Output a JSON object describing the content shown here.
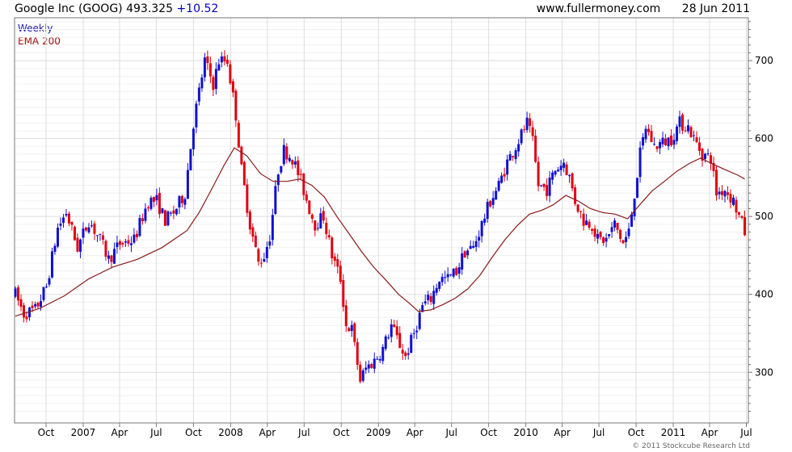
{
  "header": {
    "ticker": "Google Inc (GOOG)",
    "price": "493.325",
    "change": "+10.52",
    "site": "www.fullermoney.com",
    "date": "28 Jun 2011"
  },
  "legend": {
    "weekly": "Weekly",
    "ema": "EMA 200"
  },
  "copyright": "© 2011 Stockcube Research Ltd",
  "colors": {
    "up": "#1010d0",
    "down": "#e00010",
    "ema": "#8b1a1a",
    "grid": "#dddddd",
    "frame": "#777777"
  },
  "chart_data": {
    "type": "candlestick",
    "grid": true,
    "yaxis_side": "right",
    "ylim": [
      235,
      755
    ],
    "yticks": [
      300,
      400,
      500,
      600,
      700
    ],
    "xlim": [
      "2006-07-15",
      "2011-07-06"
    ],
    "xticks": [
      {
        "label": "Oct",
        "date": "2006-10-01"
      },
      {
        "label": "2007",
        "date": "2007-01-01"
      },
      {
        "label": "Apr",
        "date": "2007-04-01"
      },
      {
        "label": "Jul",
        "date": "2007-07-01"
      },
      {
        "label": "Oct",
        "date": "2007-10-01"
      },
      {
        "label": "2008",
        "date": "2008-01-01"
      },
      {
        "label": "Apr",
        "date": "2008-04-01"
      },
      {
        "label": "Jul",
        "date": "2008-07-01"
      },
      {
        "label": "Oct",
        "date": "2008-10-01"
      },
      {
        "label": "2009",
        "date": "2009-01-01"
      },
      {
        "label": "Apr",
        "date": "2009-04-01"
      },
      {
        "label": "Jul",
        "date": "2009-07-01"
      },
      {
        "label": "Oct",
        "date": "2009-10-01"
      },
      {
        "label": "2010",
        "date": "2010-01-01"
      },
      {
        "label": "Apr",
        "date": "2010-04-01"
      },
      {
        "label": "Jul",
        "date": "2010-07-01"
      },
      {
        "label": "Oct",
        "date": "2010-10-01"
      },
      {
        "label": "2011",
        "date": "2011-01-01"
      },
      {
        "label": "Apr",
        "date": "2011-04-01"
      },
      {
        "label": "Jul",
        "date": "2011-07-01"
      }
    ],
    "price_path": [
      [
        "2006-07-17",
        400
      ],
      [
        "2006-08-07",
        375
      ],
      [
        "2006-09-04",
        380
      ],
      [
        "2006-10-02",
        410
      ],
      [
        "2006-10-30",
        485
      ],
      [
        "2006-11-20",
        505
      ],
      [
        "2006-12-18",
        460
      ],
      [
        "2007-01-15",
        495
      ],
      [
        "2007-02-12",
        470
      ],
      [
        "2007-03-05",
        445
      ],
      [
        "2007-04-02",
        465
      ],
      [
        "2007-05-07",
        470
      ],
      [
        "2007-06-11",
        520
      ],
      [
        "2007-07-02",
        520
      ],
      [
        "2007-07-23",
        495
      ],
      [
        "2007-08-13",
        505
      ],
      [
        "2007-09-10",
        530
      ],
      [
        "2007-10-01",
        620
      ],
      [
        "2007-10-29",
        700
      ],
      [
        "2007-11-19",
        670
      ],
      [
        "2007-12-03",
        700
      ],
      [
        "2007-12-24",
        700
      ],
      [
        "2008-01-14",
        630
      ],
      [
        "2008-01-28",
        560
      ],
      [
        "2008-02-18",
        490
      ],
      [
        "2008-03-10",
        440
      ],
      [
        "2008-03-24",
        450
      ],
      [
        "2008-04-07",
        475
      ],
      [
        "2008-04-28",
        560
      ],
      [
        "2008-05-12",
        585
      ],
      [
        "2008-06-02",
        575
      ],
      [
        "2008-06-23",
        545
      ],
      [
        "2008-07-14",
        510
      ],
      [
        "2008-07-28",
        490
      ],
      [
        "2008-08-18",
        500
      ],
      [
        "2008-09-08",
        450
      ],
      [
        "2008-09-29",
        420
      ],
      [
        "2008-10-13",
        360
      ],
      [
        "2008-10-27",
        355
      ],
      [
        "2008-11-17",
        290
      ],
      [
        "2008-12-01",
        305
      ],
      [
        "2008-12-22",
        315
      ],
      [
        "2009-01-12",
        330
      ],
      [
        "2009-02-02",
        360
      ],
      [
        "2009-02-23",
        335
      ],
      [
        "2009-03-09",
        320
      ],
      [
        "2009-03-30",
        350
      ],
      [
        "2009-04-20",
        385
      ],
      [
        "2009-05-11",
        395
      ],
      [
        "2009-06-01",
        420
      ],
      [
        "2009-06-22",
        420
      ],
      [
        "2009-07-13",
        430
      ],
      [
        "2009-08-03",
        455
      ],
      [
        "2009-08-24",
        460
      ],
      [
        "2009-09-14",
        490
      ],
      [
        "2009-10-05",
        520
      ],
      [
        "2009-10-26",
        540
      ],
      [
        "2009-11-16",
        570
      ],
      [
        "2009-12-07",
        590
      ],
      [
        "2010-01-04",
        620
      ],
      [
        "2010-01-18",
        595
      ],
      [
        "2010-02-01",
        540
      ],
      [
        "2010-02-22",
        535
      ],
      [
        "2010-03-15",
        560
      ],
      [
        "2010-04-05",
        570
      ],
      [
        "2010-04-19",
        550
      ],
      [
        "2010-05-03",
        520
      ],
      [
        "2010-05-24",
        495
      ],
      [
        "2010-06-14",
        490
      ],
      [
        "2010-06-28",
        470
      ],
      [
        "2010-07-19",
        470
      ],
      [
        "2010-08-09",
        490
      ],
      [
        "2010-08-30",
        465
      ],
      [
        "2010-09-13",
        480
      ],
      [
        "2010-09-27",
        530
      ],
      [
        "2010-10-11",
        580
      ],
      [
        "2010-10-25",
        615
      ],
      [
        "2010-11-15",
        590
      ],
      [
        "2010-12-06",
        595
      ],
      [
        "2010-12-27",
        600
      ],
      [
        "2011-01-17",
        620
      ],
      [
        "2011-02-07",
        615
      ],
      [
        "2011-02-21",
        600
      ],
      [
        "2011-03-14",
        580
      ],
      [
        "2011-04-04",
        575
      ],
      [
        "2011-04-18",
        530
      ],
      [
        "2011-05-09",
        535
      ],
      [
        "2011-05-30",
        520
      ],
      [
        "2011-06-13",
        500
      ],
      [
        "2011-06-27",
        480
      ]
    ],
    "ema_200": [
      [
        "2006-07-17",
        372
      ],
      [
        "2006-09-15",
        382
      ],
      [
        "2006-11-15",
        398
      ],
      [
        "2007-01-15",
        420
      ],
      [
        "2007-03-15",
        435
      ],
      [
        "2007-05-15",
        445
      ],
      [
        "2007-07-15",
        460
      ],
      [
        "2007-09-15",
        482
      ],
      [
        "2007-10-15",
        505
      ],
      [
        "2007-11-15",
        535
      ],
      [
        "2007-12-15",
        565
      ],
      [
        "2008-01-10",
        588
      ],
      [
        "2008-02-10",
        578
      ],
      [
        "2008-03-15",
        555
      ],
      [
        "2008-04-15",
        545
      ],
      [
        "2008-05-20",
        545
      ],
      [
        "2008-06-20",
        548
      ],
      [
        "2008-07-20",
        540
      ],
      [
        "2008-08-20",
        525
      ],
      [
        "2008-09-20",
        500
      ],
      [
        "2008-10-20",
        478
      ],
      [
        "2008-11-20",
        455
      ],
      [
        "2008-12-20",
        435
      ],
      [
        "2009-01-20",
        418
      ],
      [
        "2009-02-20",
        400
      ],
      [
        "2009-03-20",
        388
      ],
      [
        "2009-04-10",
        378
      ],
      [
        "2009-05-10",
        380
      ],
      [
        "2009-06-10",
        387
      ],
      [
        "2009-07-10",
        395
      ],
      [
        "2009-08-10",
        407
      ],
      [
        "2009-09-10",
        425
      ],
      [
        "2009-10-10",
        448
      ],
      [
        "2009-11-10",
        470
      ],
      [
        "2009-12-10",
        488
      ],
      [
        "2010-01-10",
        503
      ],
      [
        "2010-02-10",
        508
      ],
      [
        "2010-03-10",
        515
      ],
      [
        "2010-04-10",
        527
      ],
      [
        "2010-05-10",
        520
      ],
      [
        "2010-06-10",
        510
      ],
      [
        "2010-07-10",
        505
      ],
      [
        "2010-08-10",
        503
      ],
      [
        "2010-09-10",
        497
      ],
      [
        "2010-10-10",
        515
      ],
      [
        "2010-11-10",
        533
      ],
      [
        "2010-12-10",
        545
      ],
      [
        "2011-01-10",
        558
      ],
      [
        "2011-02-10",
        568
      ],
      [
        "2011-03-10",
        575
      ],
      [
        "2011-04-10",
        567
      ],
      [
        "2011-05-10",
        560
      ],
      [
        "2011-06-10",
        553
      ],
      [
        "2011-06-27",
        548
      ]
    ]
  }
}
